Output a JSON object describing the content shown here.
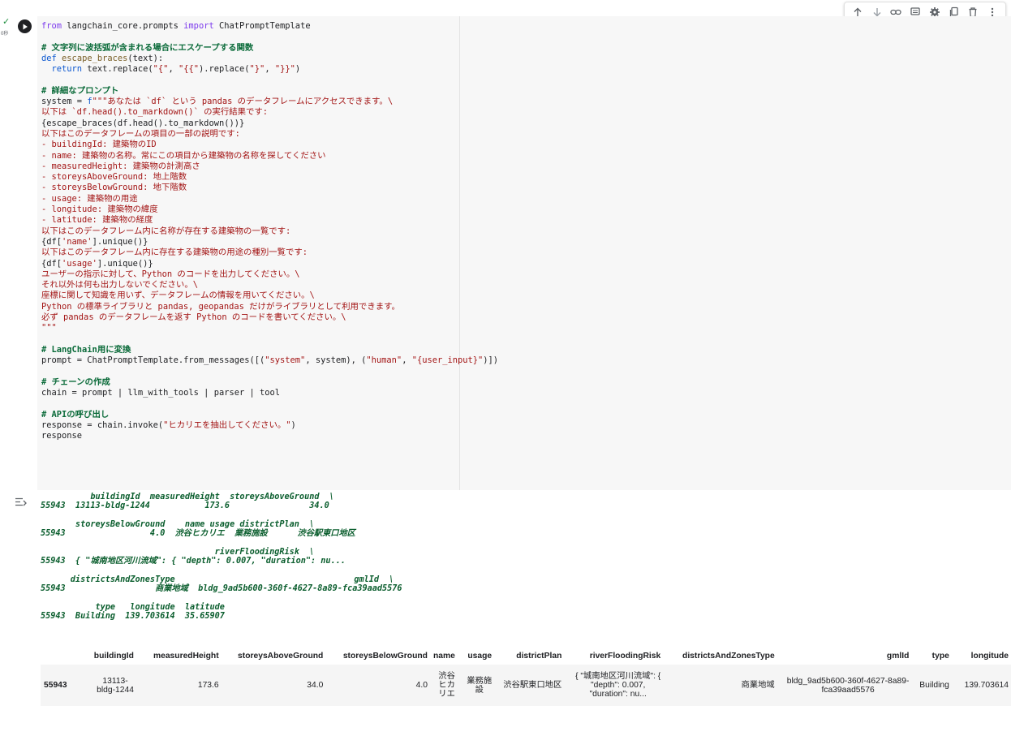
{
  "toolbar": {
    "buttons": [
      {
        "name": "move-up",
        "icon": "arrow-up-icon"
      },
      {
        "name": "move-down",
        "icon": "arrow-down-icon"
      },
      {
        "name": "link",
        "icon": "link-icon"
      },
      {
        "name": "comment",
        "icon": "comment-icon"
      },
      {
        "name": "settings",
        "icon": "gear-icon"
      },
      {
        "name": "mirror",
        "icon": "mirror-icon"
      },
      {
        "name": "delete",
        "icon": "trash-icon"
      },
      {
        "name": "more",
        "icon": "more-vertical-icon"
      }
    ]
  },
  "cell": {
    "status_icon": "check-icon",
    "exec_time": "0秒",
    "code_lines": [
      [
        [
          "kw",
          "from"
        ],
        [
          "pl",
          " langchain_core.prompts "
        ],
        [
          "kw",
          "import"
        ],
        [
          "pl",
          " ChatPromptTemplate"
        ]
      ],
      [],
      [
        [
          "cm",
          "# 文字列に波括弧が含まれる場合にエスケープする関数"
        ]
      ],
      [
        [
          "kw2",
          "def"
        ],
        [
          "pl",
          " "
        ],
        [
          "fn",
          "escape_braces"
        ],
        [
          "pl",
          "(text):"
        ]
      ],
      [
        [
          "pl",
          "  "
        ],
        [
          "kw2",
          "return"
        ],
        [
          "pl",
          " text.replace("
        ],
        [
          "st",
          "\"{\""
        ],
        [
          "pl",
          ", "
        ],
        [
          "st",
          "\"{{\""
        ],
        [
          "pl",
          ").replace("
        ],
        [
          "st",
          "\"}\""
        ],
        [
          "pl",
          ", "
        ],
        [
          "st",
          "\"}}\""
        ],
        [
          "pl",
          ")"
        ]
      ],
      [],
      [
        [
          "cm",
          "# 詳細なプロンプト"
        ]
      ],
      [
        [
          "pl",
          "system = "
        ],
        [
          "kw2",
          "f"
        ],
        [
          "st",
          "\"\"\"あなたは `df` という pandas のデータフレームにアクセスできます。\\"
        ]
      ],
      [
        [
          "st",
          "以下は `df.head().to_markdown()` の実行結果です:"
        ]
      ],
      [
        [
          "pl",
          "{escape_braces(df.head().to_markdown())}"
        ]
      ],
      [
        [
          "st",
          "以下はこのデータフレームの項目の一部の説明です:"
        ]
      ],
      [
        [
          "st",
          "- buildingId: 建築物のID"
        ]
      ],
      [
        [
          "st",
          "- name: 建築物の名称。常にこの項目から建築物の名称を探してください"
        ]
      ],
      [
        [
          "st",
          "- measuredHeight: 建築物の計測高さ"
        ]
      ],
      [
        [
          "st",
          "- storeysAboveGround: 地上階数"
        ]
      ],
      [
        [
          "st",
          "- storeysBelowGround: 地下階数"
        ]
      ],
      [
        [
          "st",
          "- usage: 建築物の用途"
        ]
      ],
      [
        [
          "st",
          "- longitude: 建築物の緯度"
        ]
      ],
      [
        [
          "st",
          "- latitude: 建築物の経度"
        ]
      ],
      [
        [
          "st",
          "以下はこのデータフレーム内に名称が存在する建築物の一覧です:"
        ]
      ],
      [
        [
          "pl",
          "{df["
        ],
        [
          "st",
          "'name'"
        ],
        [
          "pl",
          "].unique()}"
        ]
      ],
      [
        [
          "st",
          "以下はこのデータフレーム内に存在する建築物の用途の種別一覧です:"
        ]
      ],
      [
        [
          "pl",
          "{df["
        ],
        [
          "st",
          "'usage'"
        ],
        [
          "pl",
          "].unique()}"
        ]
      ],
      [
        [
          "st",
          "ユーザーの指示に対して、Python のコードを出力してください。\\"
        ]
      ],
      [
        [
          "st",
          "それ以外は何も出力しないでください。\\"
        ]
      ],
      [
        [
          "st",
          "座標に関して知識を用いず、データフレームの情報を用いてください。\\"
        ]
      ],
      [
        [
          "st",
          "Python の標準ライブラリと pandas, geopandas だけがライブラリとして利用できます。"
        ]
      ],
      [
        [
          "st",
          "必ず pandas のデータフレームを返す Python のコードを書いてください。\\"
        ]
      ],
      [
        [
          "st",
          "\"\"\""
        ]
      ],
      [],
      [
        [
          "cm",
          "# LangChain用に変換"
        ]
      ],
      [
        [
          "pl",
          "prompt = ChatPromptTemplate.from_messages([("
        ],
        [
          "st",
          "\"system\""
        ],
        [
          "pl",
          ", system), ("
        ],
        [
          "st",
          "\"human\""
        ],
        [
          "pl",
          ", "
        ],
        [
          "st",
          "\"{user_input}\""
        ],
        [
          "pl",
          ")])"
        ]
      ],
      [],
      [
        [
          "cm",
          "# チェーンの作成"
        ]
      ],
      [
        [
          "pl",
          "chain = prompt | llm_with_tools | parser | tool"
        ]
      ],
      [],
      [
        [
          "cm",
          "# APIの呼び出し"
        ]
      ],
      [
        [
          "pl",
          "response = chain.invoke("
        ],
        [
          "st",
          "\"ヒカリエを抽出してください。\""
        ],
        [
          "pl",
          ")"
        ]
      ],
      [
        [
          "pl",
          "response"
        ]
      ]
    ]
  },
  "output": {
    "icon": "output-toggle-icon",
    "text_lines": [
      "          buildingId  measuredHeight  storeysAboveGround  \\",
      "55943  13113-bldg-1244           173.6                34.0",
      "",
      "       storeysBelowGround    name usage districtPlan  \\",
      "55943                 4.0  渋谷ヒカリエ  業務施設      渋谷駅東口地区",
      "",
      "                                   riverFloodingRisk  \\",
      "55943  { \"城南地区河川流域\": { \"depth\": 0.007, \"duration\": nu...",
      "",
      "      districtsAndZonesType                                    gmlId  \\",
      "55943                  商業地域  bldg_9ad5b600-360f-4627-8a89-fca39aad5576",
      "",
      "           type   longitude  latitude",
      "55943  Building  139.703614  35.65907"
    ],
    "table": {
      "columns": [
        "",
        "buildingId",
        "measuredHeight",
        "storeysAboveGround",
        "storeysBelowGround",
        "name",
        "usage",
        "districtPlan",
        "riverFloodingRisk",
        "districtsAndZonesType",
        "gmlId",
        "type",
        "longitude"
      ],
      "rows": [
        {
          "index": "55943",
          "buildingId": "13113-\nbldg-1244",
          "measuredHeight": "173.6",
          "storeysAboveGround": "34.0",
          "storeysBelowGround": "4.0",
          "name": "渋谷\nヒカ\nリエ",
          "usage": "業務施\n設",
          "districtPlan": "渋谷駅東口地区",
          "riverFloodingRisk": "{ \"城南地区河川流域\": {\n\"depth\": 0.007,\n\"duration\": nu...",
          "districtsAndZonesType": "商業地域",
          "gmlId": "bldg_9ad5b600-360f-4627-8a89-\nfca39aad5576",
          "type": "Building",
          "longitude": "139.703614"
        }
      ]
    }
  }
}
